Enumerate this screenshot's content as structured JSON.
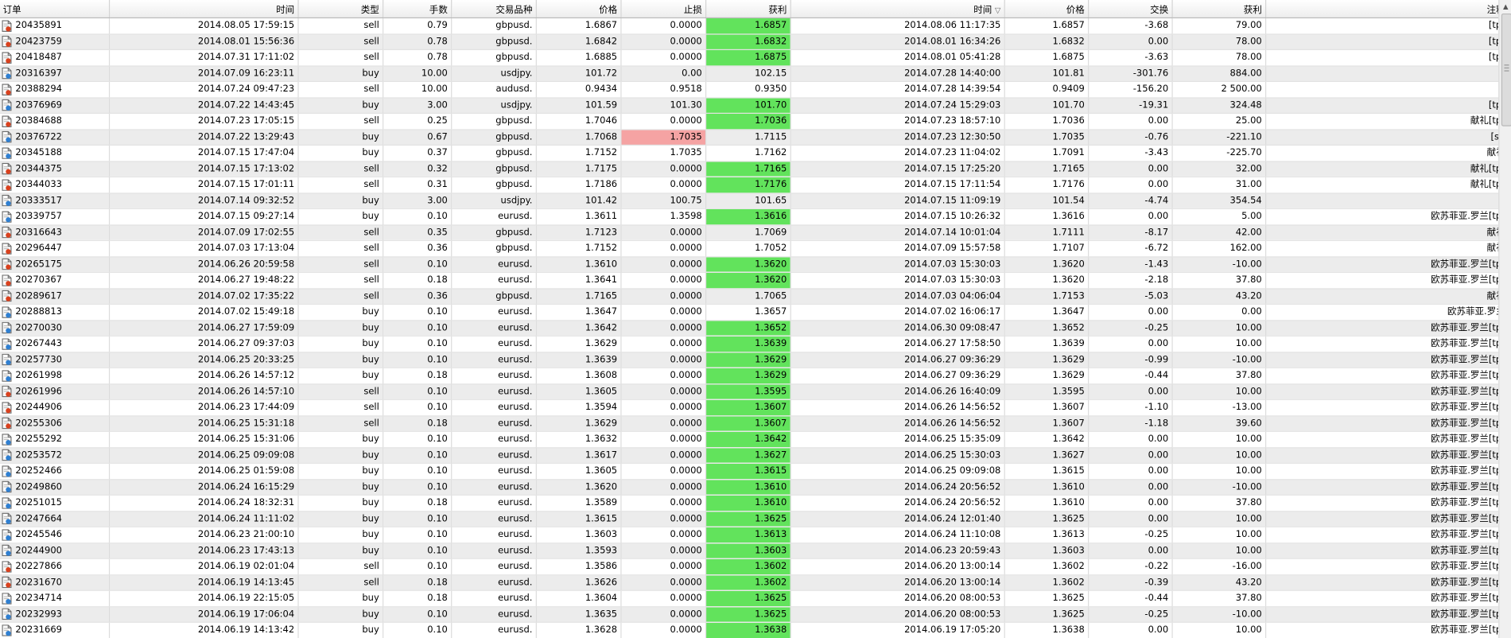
{
  "columns": [
    {
      "key": "order",
      "label": "订单"
    },
    {
      "key": "open_time",
      "label": "时间"
    },
    {
      "key": "type",
      "label": "类型"
    },
    {
      "key": "lots",
      "label": "手数"
    },
    {
      "key": "symbol",
      "label": "交易品种"
    },
    {
      "key": "open_price",
      "label": "价格"
    },
    {
      "key": "sl",
      "label": "止损"
    },
    {
      "key": "tp",
      "label": "获利"
    },
    {
      "key": "close_time",
      "label": "时间"
    },
    {
      "key": "close_price",
      "label": "价格"
    },
    {
      "key": "swap",
      "label": "交换"
    },
    {
      "key": "profit",
      "label": "获利"
    },
    {
      "key": "comment",
      "label": "注释"
    }
  ],
  "sorted_column": "close_time",
  "colors": {
    "highlight_tp": "#62e35c",
    "highlight_sl": "#f5a3a3",
    "row_alt": "#ececec"
  },
  "icons": {
    "sell_row": "document-red-icon",
    "buy_row": "document-blue-icon"
  },
  "rows": [
    [
      "20435891",
      "2014.08.05 17:59:15",
      "sell",
      "0.79",
      "gbpusd.",
      "1.6867",
      "0.0000",
      "1.6857",
      "2014.08.06 11:17:35",
      "1.6857",
      "-3.68",
      "79.00",
      "[tp]"
    ],
    [
      "20423759",
      "2014.08.01 15:56:36",
      "sell",
      "0.78",
      "gbpusd.",
      "1.6842",
      "0.0000",
      "1.6832",
      "2014.08.01 16:34:26",
      "1.6832",
      "0.00",
      "78.00",
      "[tp]"
    ],
    [
      "20418487",
      "2014.07.31 17:11:02",
      "sell",
      "0.78",
      "gbpusd.",
      "1.6885",
      "0.0000",
      "1.6875",
      "2014.08.01 05:41:28",
      "1.6875",
      "-3.63",
      "78.00",
      "[tp]"
    ],
    [
      "20316397",
      "2014.07.09 16:23:11",
      "buy",
      "10.00",
      "usdjpy.",
      "101.72",
      "0.00",
      "102.15",
      "2014.07.28 14:40:00",
      "101.81",
      "-301.76",
      "884.00",
      ""
    ],
    [
      "20388294",
      "2014.07.24 09:47:23",
      "sell",
      "10.00",
      "audusd.",
      "0.9434",
      "0.9518",
      "0.9350",
      "2014.07.28 14:39:54",
      "0.9409",
      "-156.20",
      "2 500.00",
      ""
    ],
    [
      "20376969",
      "2014.07.22 14:43:45",
      "buy",
      "3.00",
      "usdjpy.",
      "101.59",
      "101.30",
      "101.70",
      "2014.07.24 15:29:03",
      "101.70",
      "-19.31",
      "324.48",
      "[tp]"
    ],
    [
      "20384688",
      "2014.07.23 17:05:15",
      "sell",
      "0.25",
      "gbpusd.",
      "1.7046",
      "0.0000",
      "1.7036",
      "2014.07.23 18:57:10",
      "1.7036",
      "0.00",
      "25.00",
      "献礼[tp]"
    ],
    [
      "20376722",
      "2014.07.22 13:29:43",
      "buy",
      "0.67",
      "gbpusd.",
      "1.7068",
      "1.7035",
      "1.7115",
      "2014.07.23 12:30:50",
      "1.7035",
      "-0.76",
      "-221.10",
      "[sl]"
    ],
    [
      "20345188",
      "2014.07.15 17:47:04",
      "buy",
      "0.37",
      "gbpusd.",
      "1.7152",
      "1.7035",
      "1.7162",
      "2014.07.23 11:04:02",
      "1.7091",
      "-3.43",
      "-225.70",
      "献礼"
    ],
    [
      "20344375",
      "2014.07.15 17:13:02",
      "sell",
      "0.32",
      "gbpusd.",
      "1.7175",
      "0.0000",
      "1.7165",
      "2014.07.15 17:25:20",
      "1.7165",
      "0.00",
      "32.00",
      "献礼[tp]"
    ],
    [
      "20344033",
      "2014.07.15 17:01:11",
      "sell",
      "0.31",
      "gbpusd.",
      "1.7186",
      "0.0000",
      "1.7176",
      "2014.07.15 17:11:54",
      "1.7176",
      "0.00",
      "31.00",
      "献礼[tp]"
    ],
    [
      "20333517",
      "2014.07.14 09:32:52",
      "buy",
      "3.00",
      "usdjpy.",
      "101.42",
      "100.75",
      "101.65",
      "2014.07.15 11:09:19",
      "101.54",
      "-4.74",
      "354.54",
      ""
    ],
    [
      "20339757",
      "2014.07.15 09:27:14",
      "buy",
      "0.10",
      "eurusd.",
      "1.3611",
      "1.3598",
      "1.3616",
      "2014.07.15 10:26:32",
      "1.3616",
      "0.00",
      "5.00",
      "欧苏菲亚.罗兰[tp]"
    ],
    [
      "20316643",
      "2014.07.09 17:02:55",
      "sell",
      "0.35",
      "gbpusd.",
      "1.7123",
      "0.0000",
      "1.7069",
      "2014.07.14 10:01:04",
      "1.7111",
      "-8.17",
      "42.00",
      "献礼"
    ],
    [
      "20296447",
      "2014.07.03 17:13:04",
      "sell",
      "0.36",
      "gbpusd.",
      "1.7152",
      "0.0000",
      "1.7052",
      "2014.07.09 15:57:58",
      "1.7107",
      "-6.72",
      "162.00",
      "献礼"
    ],
    [
      "20265175",
      "2014.06.26 20:59:58",
      "sell",
      "0.10",
      "eurusd.",
      "1.3610",
      "0.0000",
      "1.3620",
      "2014.07.03 15:30:03",
      "1.3620",
      "-1.43",
      "-10.00",
      "欧苏菲亚.罗兰[tp]"
    ],
    [
      "20270367",
      "2014.06.27 19:48:22",
      "sell",
      "0.18",
      "eurusd.",
      "1.3641",
      "0.0000",
      "1.3620",
      "2014.07.03 15:30:03",
      "1.3620",
      "-2.18",
      "37.80",
      "欧苏菲亚.罗兰[tp]"
    ],
    [
      "20289617",
      "2014.07.02 17:35:22",
      "sell",
      "0.36",
      "gbpusd.",
      "1.7165",
      "0.0000",
      "1.7065",
      "2014.07.03 04:06:04",
      "1.7153",
      "-5.03",
      "43.20",
      "献礼"
    ],
    [
      "20288813",
      "2014.07.02 15:49:18",
      "buy",
      "0.10",
      "eurusd.",
      "1.3647",
      "0.0000",
      "1.3657",
      "2014.07.02 16:06:17",
      "1.3647",
      "0.00",
      "0.00",
      "欧苏菲亚.罗兰"
    ],
    [
      "20270030",
      "2014.06.27 17:59:09",
      "buy",
      "0.10",
      "eurusd.",
      "1.3642",
      "0.0000",
      "1.3652",
      "2014.06.30 09:08:47",
      "1.3652",
      "-0.25",
      "10.00",
      "欧苏菲亚.罗兰[tp]"
    ],
    [
      "20267443",
      "2014.06.27 09:37:03",
      "buy",
      "0.10",
      "eurusd.",
      "1.3629",
      "0.0000",
      "1.3639",
      "2014.06.27 17:58:50",
      "1.3639",
      "0.00",
      "10.00",
      "欧苏菲亚.罗兰[tp]"
    ],
    [
      "20257730",
      "2014.06.25 20:33:25",
      "buy",
      "0.10",
      "eurusd.",
      "1.3639",
      "0.0000",
      "1.3629",
      "2014.06.27 09:36:29",
      "1.3629",
      "-0.99",
      "-10.00",
      "欧苏菲亚.罗兰[tp]"
    ],
    [
      "20261998",
      "2014.06.26 14:57:12",
      "buy",
      "0.18",
      "eurusd.",
      "1.3608",
      "0.0000",
      "1.3629",
      "2014.06.27 09:36:29",
      "1.3629",
      "-0.44",
      "37.80",
      "欧苏菲亚.罗兰[tp]"
    ],
    [
      "20261996",
      "2014.06.26 14:57:10",
      "sell",
      "0.10",
      "eurusd.",
      "1.3605",
      "0.0000",
      "1.3595",
      "2014.06.26 16:40:09",
      "1.3595",
      "0.00",
      "10.00",
      "欧苏菲亚.罗兰[tp]"
    ],
    [
      "20244906",
      "2014.06.23 17:44:09",
      "sell",
      "0.10",
      "eurusd.",
      "1.3594",
      "0.0000",
      "1.3607",
      "2014.06.26 14:56:52",
      "1.3607",
      "-1.10",
      "-13.00",
      "欧苏菲亚.罗兰[tp]"
    ],
    [
      "20255306",
      "2014.06.25 15:31:18",
      "sell",
      "0.18",
      "eurusd.",
      "1.3629",
      "0.0000",
      "1.3607",
      "2014.06.26 14:56:52",
      "1.3607",
      "-1.18",
      "39.60",
      "欧苏菲亚.罗兰[tp]"
    ],
    [
      "20255292",
      "2014.06.25 15:31:06",
      "buy",
      "0.10",
      "eurusd.",
      "1.3632",
      "0.0000",
      "1.3642",
      "2014.06.25 15:35:09",
      "1.3642",
      "0.00",
      "10.00",
      "欧苏菲亚.罗兰[tp]"
    ],
    [
      "20253572",
      "2014.06.25 09:09:08",
      "buy",
      "0.10",
      "eurusd.",
      "1.3617",
      "0.0000",
      "1.3627",
      "2014.06.25 15:30:03",
      "1.3627",
      "0.00",
      "10.00",
      "欧苏菲亚.罗兰[tp]"
    ],
    [
      "20252466",
      "2014.06.25 01:59:08",
      "buy",
      "0.10",
      "eurusd.",
      "1.3605",
      "0.0000",
      "1.3615",
      "2014.06.25 09:09:08",
      "1.3615",
      "0.00",
      "10.00",
      "欧苏菲亚.罗兰[tp]"
    ],
    [
      "20249860",
      "2014.06.24 16:15:29",
      "buy",
      "0.10",
      "eurusd.",
      "1.3620",
      "0.0000",
      "1.3610",
      "2014.06.24 20:56:52",
      "1.3610",
      "0.00",
      "-10.00",
      "欧苏菲亚.罗兰[tp]"
    ],
    [
      "20251015",
      "2014.06.24 18:32:31",
      "buy",
      "0.18",
      "eurusd.",
      "1.3589",
      "0.0000",
      "1.3610",
      "2014.06.24 20:56:52",
      "1.3610",
      "0.00",
      "37.80",
      "欧苏菲亚.罗兰[tp]"
    ],
    [
      "20247664",
      "2014.06.24 11:11:02",
      "buy",
      "0.10",
      "eurusd.",
      "1.3615",
      "0.0000",
      "1.3625",
      "2014.06.24 12:01:40",
      "1.3625",
      "0.00",
      "10.00",
      "欧苏菲亚.罗兰[tp]"
    ],
    [
      "20245546",
      "2014.06.23 21:00:10",
      "buy",
      "0.10",
      "eurusd.",
      "1.3603",
      "0.0000",
      "1.3613",
      "2014.06.24 11:10:08",
      "1.3613",
      "-0.25",
      "10.00",
      "欧苏菲亚.罗兰[tp]"
    ],
    [
      "20244900",
      "2014.06.23 17:43:13",
      "buy",
      "0.10",
      "eurusd.",
      "1.3593",
      "0.0000",
      "1.3603",
      "2014.06.23 20:59:43",
      "1.3603",
      "0.00",
      "10.00",
      "欧苏菲亚.罗兰[tp]"
    ],
    [
      "20227866",
      "2014.06.19 02:01:04",
      "sell",
      "0.10",
      "eurusd.",
      "1.3586",
      "0.0000",
      "1.3602",
      "2014.06.20 13:00:14",
      "1.3602",
      "-0.22",
      "-16.00",
      "欧苏菲亚.罗兰[tp]"
    ],
    [
      "20231670",
      "2014.06.19 14:13:45",
      "sell",
      "0.18",
      "eurusd.",
      "1.3626",
      "0.0000",
      "1.3602",
      "2014.06.20 13:00:14",
      "1.3602",
      "-0.39",
      "43.20",
      "欧苏菲亚.罗兰[tp]"
    ],
    [
      "20234714",
      "2014.06.19 22:15:05",
      "buy",
      "0.18",
      "eurusd.",
      "1.3604",
      "0.0000",
      "1.3625",
      "2014.06.20 08:00:53",
      "1.3625",
      "-0.44",
      "37.80",
      "欧苏菲亚.罗兰[tp]"
    ],
    [
      "20232993",
      "2014.06.19 17:06:04",
      "buy",
      "0.10",
      "eurusd.",
      "1.3635",
      "0.0000",
      "1.3625",
      "2014.06.20 08:00:53",
      "1.3625",
      "-0.25",
      "-10.00",
      "欧苏菲亚.罗兰[tp]"
    ],
    [
      "20231669",
      "2014.06.19 14:13:42",
      "buy",
      "0.10",
      "eurusd.",
      "1.3628",
      "0.0000",
      "1.3638",
      "2014.06.19 17:05:20",
      "1.3638",
      "0.00",
      "10.00",
      "欧苏菲亚.罗兰[tp]"
    ]
  ],
  "highlight_tp_rows": [
    0,
    1,
    2,
    5,
    6,
    9,
    10,
    12,
    15,
    16,
    19,
    20,
    21,
    22,
    23,
    24,
    25,
    26,
    27,
    28,
    29,
    30,
    31,
    32,
    33,
    34,
    35,
    36,
    37,
    38
  ],
  "highlight_sl_rows": [
    7
  ]
}
